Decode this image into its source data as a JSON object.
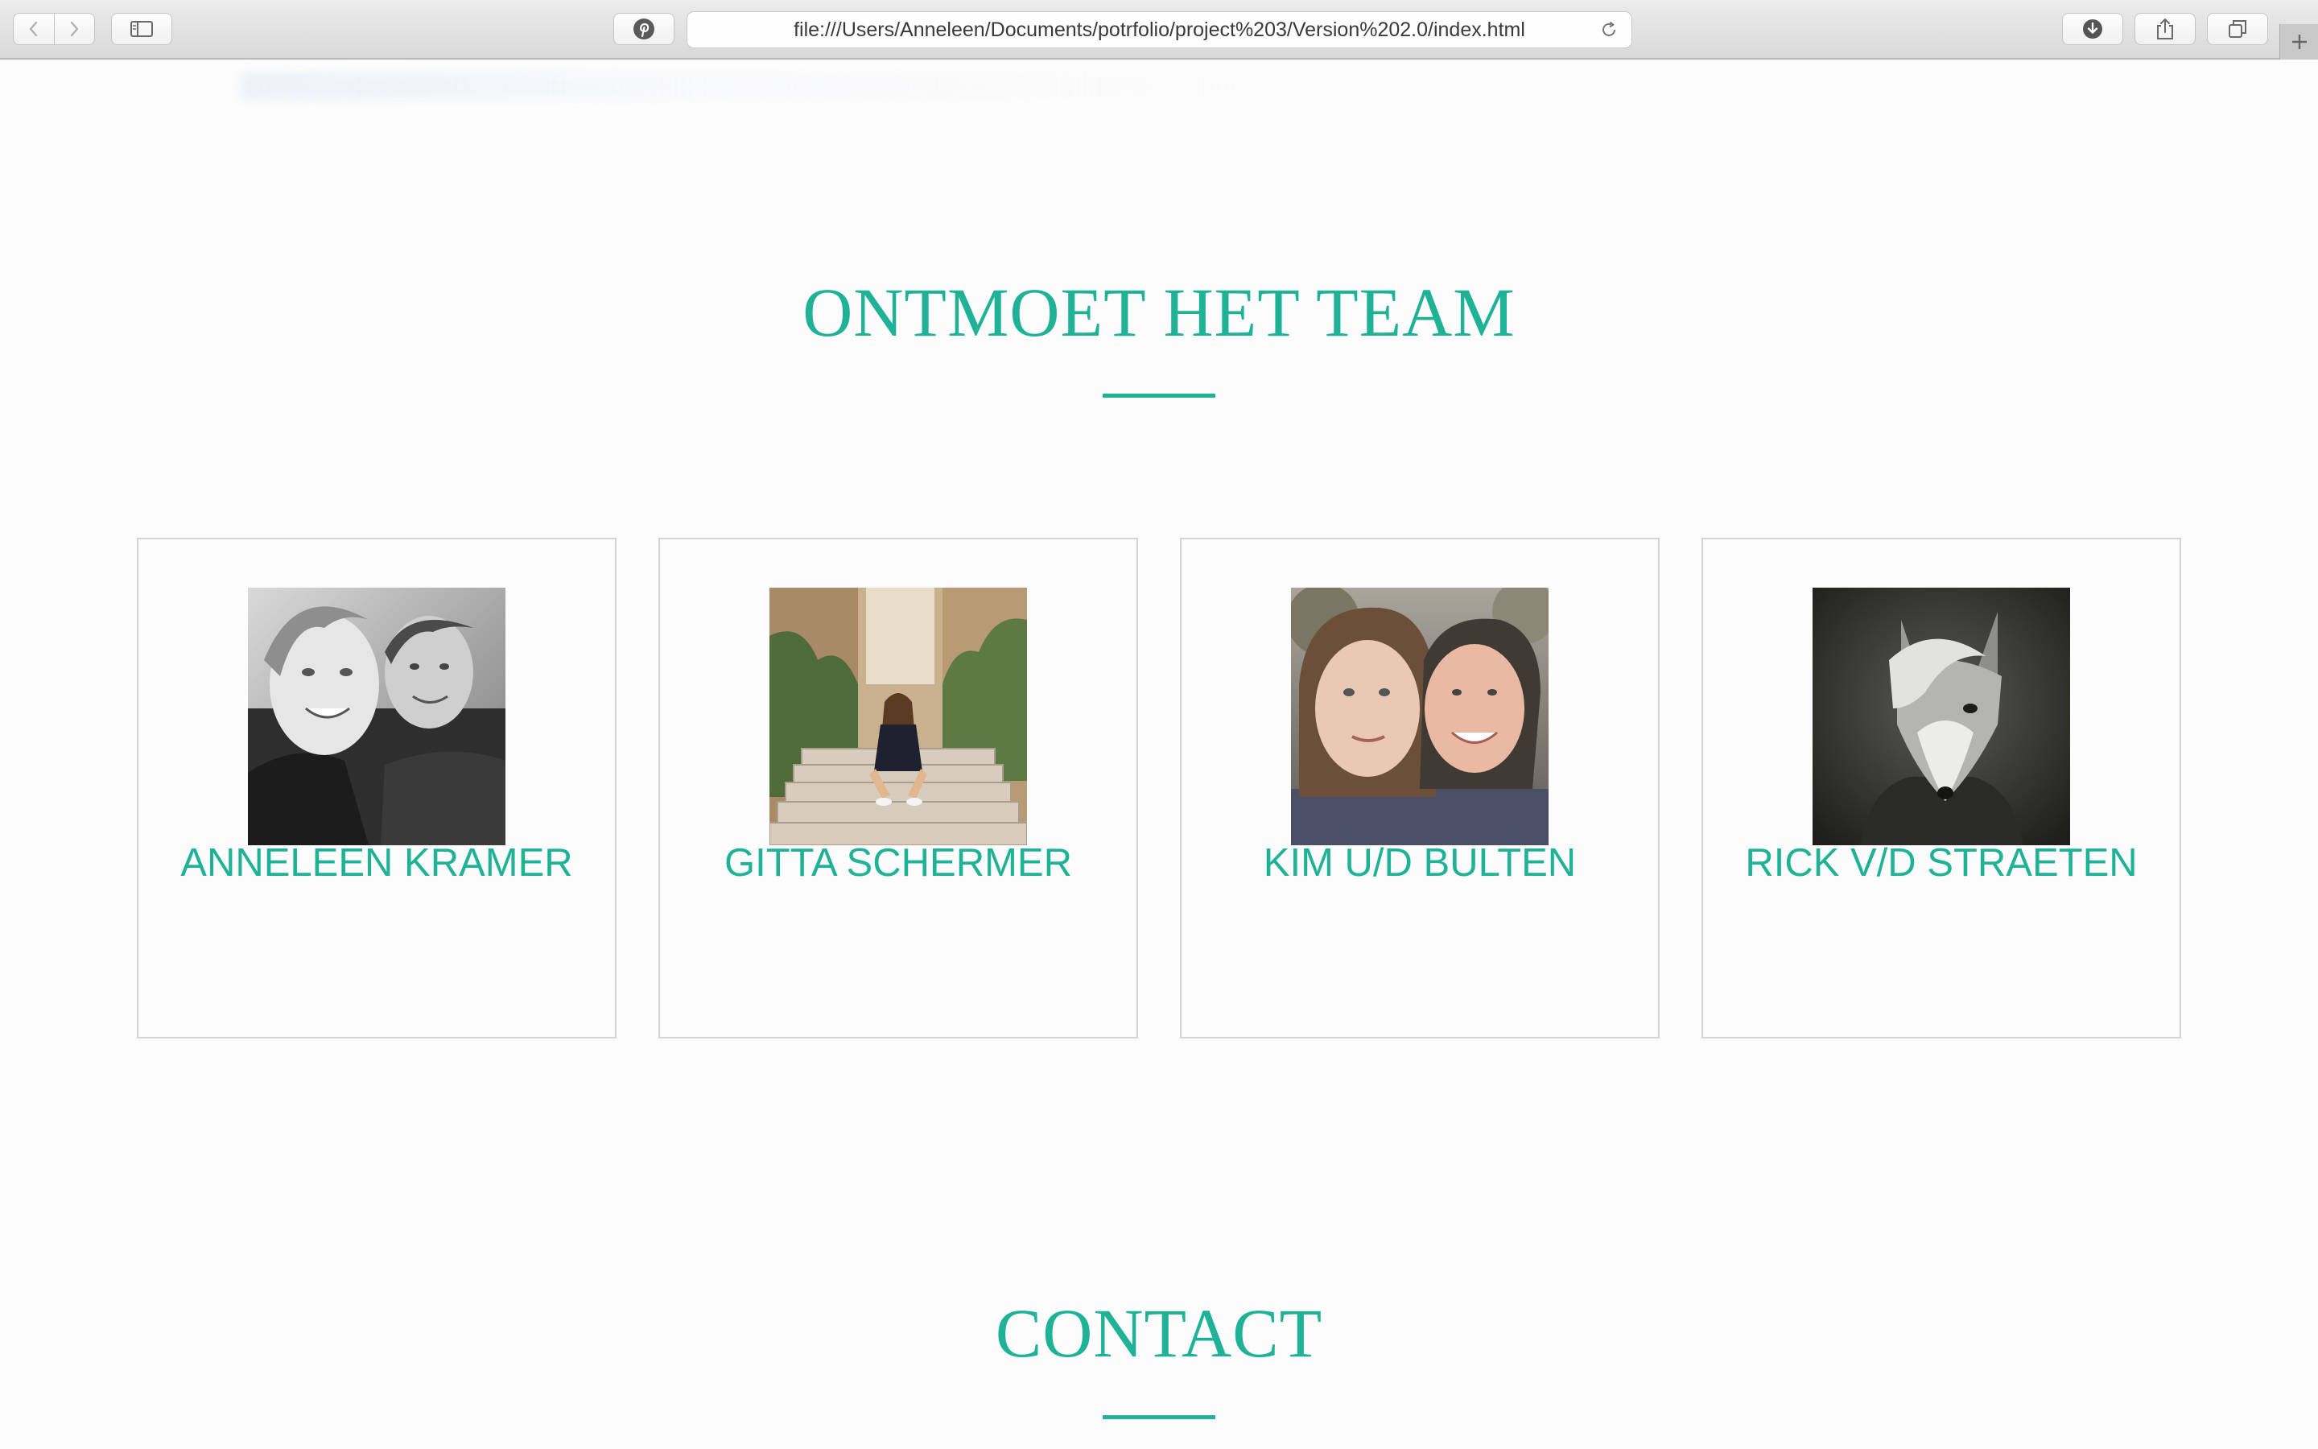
{
  "browser": {
    "url": "file:///Users/Anneleen/Documents/potrfolio/project%203/Version%202.0/index.html",
    "icons": {
      "back": "chevron-left-icon",
      "forward": "chevron-right-icon",
      "sidebar": "sidebar-icon",
      "pinterest": "pinterest-icon",
      "reload": "reload-icon",
      "downloads": "download-icon",
      "share": "share-icon",
      "tabs": "tabs-icon",
      "new_tab": "plus-icon"
    }
  },
  "team": {
    "title": "ONTMOET HET TEAM",
    "members": [
      {
        "name": "ANNELEEN KRAMER",
        "photo": "selfie of two people, black and white"
      },
      {
        "name": "GITTA SCHERMER",
        "photo": "woman sitting on stone steps in narrow street"
      },
      {
        "name": "KIM U/D BULTEN",
        "photo": "selfie of two people outdoors"
      },
      {
        "name": "RICK V/D STRAETEN",
        "photo": "person with fox head, monochrome"
      }
    ]
  },
  "contact": {
    "title": "CONTACT"
  },
  "colors": {
    "accent": "#1fb296",
    "background": "#fcfcfc",
    "card_border": "#d3d3d3"
  }
}
